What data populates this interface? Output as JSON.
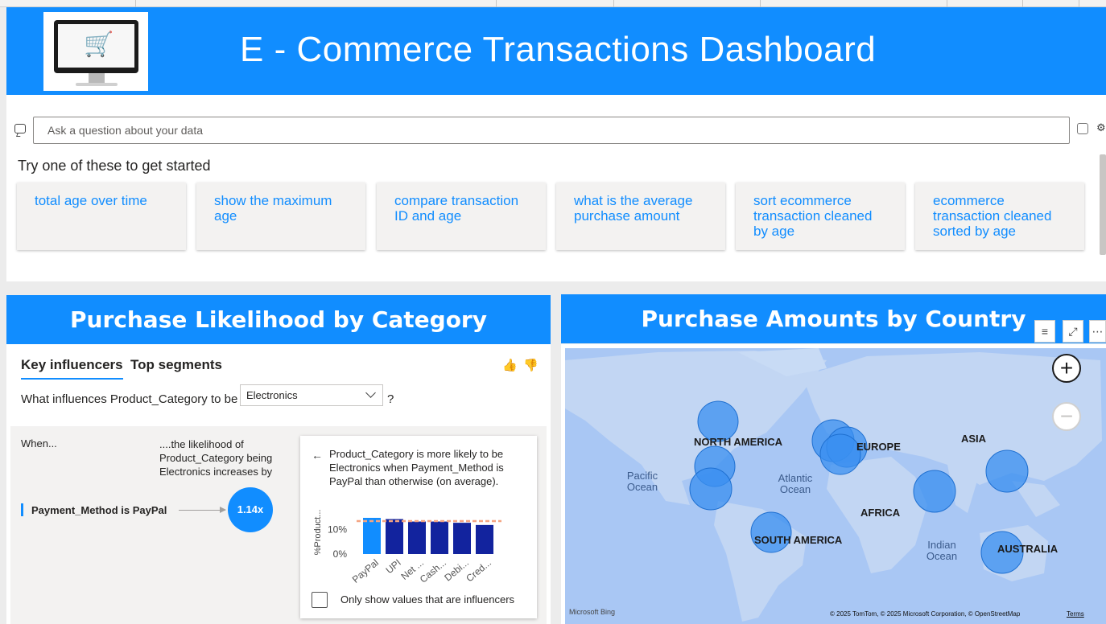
{
  "header": {
    "title": "E - Commerce Transactions Dashboard"
  },
  "qa": {
    "placeholder": "Ask a question about your data",
    "prompt": "Try one of these to get started",
    "suggestions": [
      "total age over time",
      "show the maximum age",
      "compare transaction ID and age",
      "what is the average purchase amount",
      "sort ecommerce transaction cleaned by age",
      "ecommerce transaction cleaned sorted by age"
    ]
  },
  "purchase_likelihood": {
    "title": "Purchase Likelihood by Category",
    "tabs": [
      "Key influencers",
      "Top segments"
    ],
    "question": "What influences Product_Category to be",
    "selected": "Electronics",
    "question_end": "?",
    "when_label": "When...",
    "likelihood_label": "....the likelihood of Product_Category being Electronics increases by",
    "influencer": {
      "label": "Payment_Method is PayPal",
      "value": "1.14x"
    },
    "detail_text": "Product_Category is more likely to be Electronics when Payment_Method is PayPal than otherwise (on average).",
    "checkbox_label": "Only show values that are influencers"
  },
  "map": {
    "title": "Purchase Amounts by Country",
    "labels": {
      "north_america": "NORTH AMERICA",
      "europe": "EUROPE",
      "asia": "ASIA",
      "africa": "AFRICA",
      "south_america": "SOUTH AMERICA",
      "australia": "AUSTRALIA",
      "pacific": "Pacific Ocean",
      "atlantic": "Atlantic Ocean",
      "indian": "Indian Ocean"
    },
    "attribution_logo": "Microsoft Bing",
    "attribution": "© 2025 TomTom, © 2025 Microsoft Corporation, © OpenStreetMap",
    "terms": "Terms"
  },
  "chart_data": {
    "type": "bar",
    "title": "",
    "ylabel": "%Product...",
    "categories": [
      "PayPal",
      "UPI",
      "Net ...",
      "Cash...",
      "Debi...",
      "Cred..."
    ],
    "values": [
      14.7,
      14.2,
      13.2,
      13.2,
      12.7,
      11.8
    ],
    "tick_labels": [
      "0%",
      "10%"
    ],
    "average_line": 13.4,
    "ylim": [
      0,
      16
    ],
    "colors": {
      "highlight": "#118dff",
      "bar": "#12239e",
      "average": "#f4a582"
    }
  },
  "colors": {
    "accent": "#118dff",
    "map_water": "#a9c7f4",
    "map_land": "#c2d6f3",
    "bubble": "#3a8ff0"
  }
}
